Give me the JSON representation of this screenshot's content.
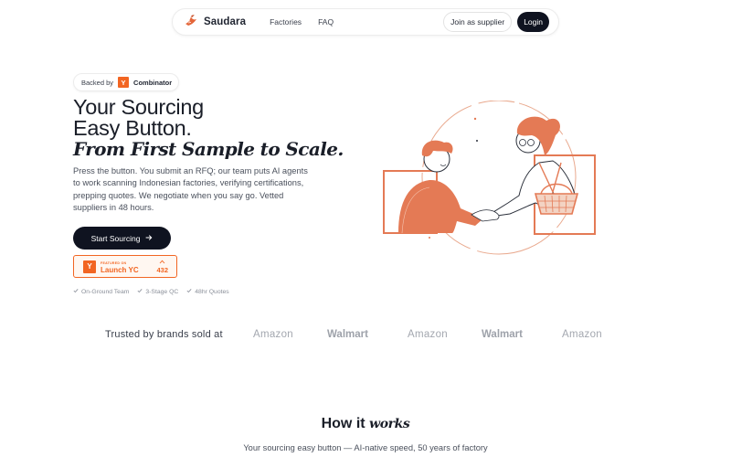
{
  "nav": {
    "brand": "Saudara",
    "links": [
      "Factories",
      "FAQ"
    ],
    "supplier_label": "Join as supplier",
    "login_label": "Login"
  },
  "badge": {
    "prefix": "Backed by",
    "yc_letter": "Y",
    "name": "Combinator"
  },
  "hero": {
    "title_line1": "Your Sourcing",
    "title_line2": "Easy Button.",
    "title_italic": "From First Sample to Scale.",
    "description": "Press the button. You submit an RFQ; our team puts AI agents to work scanning Indonesian factories, verifying certifications, prepping quotes. We negotiate when you say go. Vetted suppliers in 48 hours.",
    "cta_label": "Start Sourcing",
    "cta_icon": "arrow-right-icon"
  },
  "launch": {
    "small": "FEATURED ON",
    "big": "Launch YC",
    "votes": "432"
  },
  "features": [
    "On-Ground Team",
    "3-Stage QC",
    "48hr Quotes"
  ],
  "trusted": {
    "label": "Trusted by brands sold at",
    "logos": [
      "Amazon",
      "Walmart",
      "Amazon",
      "Walmart",
      "Amazon"
    ]
  },
  "how": {
    "title_plain": "How it",
    "title_italic": "works",
    "subtitle": "Your sourcing easy button — AI-native speed, 50 years of factory"
  },
  "colors": {
    "accent": "#f26522",
    "illustration": "#e47a55",
    "dark": "#0f1320"
  }
}
